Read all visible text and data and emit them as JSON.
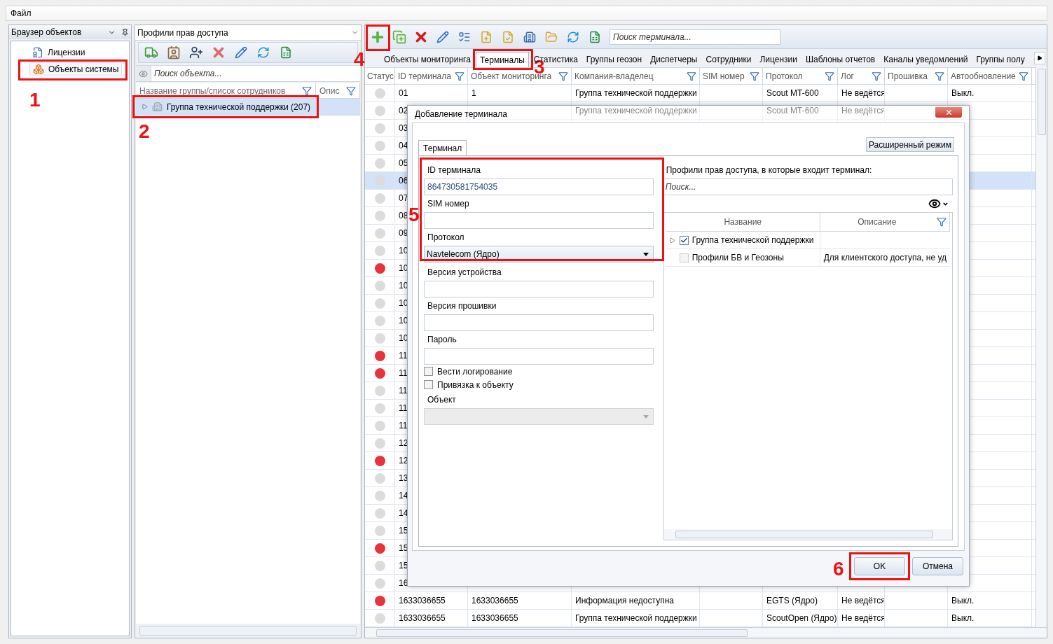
{
  "menu": [
    {
      "label": "Файл"
    }
  ],
  "object_browser": {
    "title": "Браузер объектов",
    "items": [
      {
        "label": "Лицензии",
        "selected": false
      },
      {
        "label": "Объекты системы",
        "selected": true
      }
    ]
  },
  "profiles_panel": {
    "title": "Профили прав доступа",
    "search": {
      "placeholder": "Поиск объекта..."
    },
    "columns": [
      "Название группы/список сотрудников",
      "Опис"
    ],
    "rows": [
      {
        "label": "Группа технической поддержки (207)",
        "selected": true
      }
    ]
  },
  "terminals": {
    "search": {
      "placeholder": "Поиск терминала..."
    },
    "tabs": [
      {
        "label": "Объекты мониторинга",
        "selected": false
      },
      {
        "label": "Терминалы",
        "selected": true
      },
      {
        "label": "Статистика",
        "selected": false
      },
      {
        "label": "Группы геозон",
        "selected": false
      },
      {
        "label": "Диспетчеры",
        "selected": false
      },
      {
        "label": "Сотрудники",
        "selected": false
      },
      {
        "label": "Лицензии",
        "selected": false
      },
      {
        "label": "Шаблоны отчетов",
        "selected": false
      },
      {
        "label": "Каналы уведомлений",
        "selected": false
      },
      {
        "label": "Группы полу",
        "selected": false
      }
    ],
    "columns": {
      "status": "Статус",
      "id": "ID терминала",
      "object": "Объект мониторинга",
      "company": "Компания-владелец",
      "sim": "SIM номер",
      "protocol": "Протокол",
      "log": "Лог",
      "firmware": "Прошивка",
      "autoupdate": "Автообновление"
    },
    "rows": [
      {
        "color": "#dcdcdc",
        "selected": false,
        "id": "01",
        "object": "1",
        "company": "Группа технической поддержки",
        "protocol": "Scout MT-600",
        "log": "Не ведётся",
        "autoupdate": "Выкл."
      },
      {
        "color": "#dcdcdc",
        "selected": false,
        "id": "02",
        "company": "Группа технической поддержки",
        "protocol": "Scout MT-600",
        "log": "Не ведётся"
      },
      {
        "color": "#dcdcdc",
        "selected": false,
        "id": "03"
      },
      {
        "color": "#dcdcdc",
        "selected": false,
        "id": "04"
      },
      {
        "color": "#dcdcdc",
        "selected": false,
        "id": "05"
      },
      {
        "color": "#dcdcdc",
        "selected": true,
        "id": "06"
      },
      {
        "color": "#dcdcdc",
        "selected": false,
        "id": "07"
      },
      {
        "color": "#dcdcdc",
        "selected": false,
        "id": "08"
      },
      {
        "color": "#dcdcdc",
        "selected": false,
        "id": "09"
      },
      {
        "color": "#dcdcdc",
        "selected": false,
        "id": "10"
      },
      {
        "color": "#e8333c",
        "selected": false,
        "id": "10"
      },
      {
        "color": "#dcdcdc",
        "selected": false,
        "id": "10"
      },
      {
        "color": "#dcdcdc",
        "selected": false,
        "id": "10"
      },
      {
        "color": "#dcdcdc",
        "selected": false,
        "id": "10"
      },
      {
        "color": "#dcdcdc",
        "selected": false,
        "id": "10"
      },
      {
        "color": "#e8333c",
        "selected": false,
        "id": "11"
      },
      {
        "color": "#e8333c",
        "selected": false,
        "id": "11"
      },
      {
        "color": "#dcdcdc",
        "selected": false,
        "id": "11"
      },
      {
        "color": "#dcdcdc",
        "selected": false,
        "id": "11"
      },
      {
        "color": "#dcdcdc",
        "selected": false,
        "id": "11"
      },
      {
        "color": "#dcdcdc",
        "selected": false,
        "id": "12"
      },
      {
        "color": "#e8333c",
        "selected": false,
        "id": "12"
      },
      {
        "color": "#dcdcdc",
        "selected": false,
        "id": "13"
      },
      {
        "color": "#dcdcdc",
        "selected": false,
        "id": "14"
      },
      {
        "color": "#dcdcdc",
        "selected": false,
        "id": "14"
      },
      {
        "color": "#dcdcdc",
        "selected": false,
        "id": "15"
      },
      {
        "color": "#e8333c",
        "selected": false,
        "id": "15"
      },
      {
        "color": "#dcdcdc",
        "selected": false,
        "id": "15"
      },
      {
        "color": "#dcdcdc",
        "selected": false,
        "id": "16"
      },
      {
        "color": "#e8333c",
        "selected": false,
        "id": "1633036655",
        "object": "1633036655",
        "company": "Информация недоступна",
        "protocol": "EGTS (Ядро)",
        "log": "Не ведётся",
        "autoupdate": "Выкл."
      },
      {
        "color": "#dcdcdc",
        "selected": false,
        "id": "1633036655",
        "object": "1633036655",
        "company": "Группа технической поддержки",
        "protocol": "ScoutOpen (Ядро)",
        "log": "Не ведётся",
        "autoupdate": "Выкл."
      }
    ]
  },
  "dialog": {
    "title": "Добавление терминала",
    "tab": {
      "label": "Терминал",
      "selected": true
    },
    "advanced_button": "Расширенный режим",
    "fields": [
      {
        "kind": "text",
        "label": "ID терминала",
        "value": "864730581754035"
      },
      {
        "kind": "text",
        "label": "SIM номер"
      },
      {
        "kind": "select",
        "label": "Протокол",
        "value": "Navtelecom (Ядро)",
        "disabled": false
      },
      {
        "kind": "text",
        "label": "Версия устройства"
      },
      {
        "kind": "text",
        "label": "Версия прошивки"
      },
      {
        "kind": "text",
        "label": "Пароль"
      },
      {
        "kind": "checkbox",
        "label": "Вести логирование",
        "checked": false
      },
      {
        "kind": "checkbox",
        "label": "Привязка к объекту",
        "checked": false
      },
      {
        "kind": "select",
        "label": "Объект",
        "disabled": true
      }
    ],
    "profiles": {
      "label": "Профили прав доступа, в которые входит терминал:",
      "search": {
        "placeholder": "Поиск..."
      },
      "columns": [
        "Название",
        "Описание"
      ],
      "rows": [
        {
          "label": "Группа технической поддержки",
          "checked": true,
          "disabled": false,
          "expandable": true
        },
        {
          "label": "Профили БВ и Геозоны",
          "description": "Для клиентского доступа, не уд",
          "checked": false,
          "disabled": true,
          "expandable": false
        }
      ]
    },
    "buttons": [
      "OK",
      "Отмена"
    ]
  },
  "annotations": [
    {
      "label": "1"
    },
    {
      "label": "2"
    },
    {
      "label": "3"
    },
    {
      "label": "4"
    },
    {
      "label": "5"
    },
    {
      "label": "6"
    }
  ]
}
